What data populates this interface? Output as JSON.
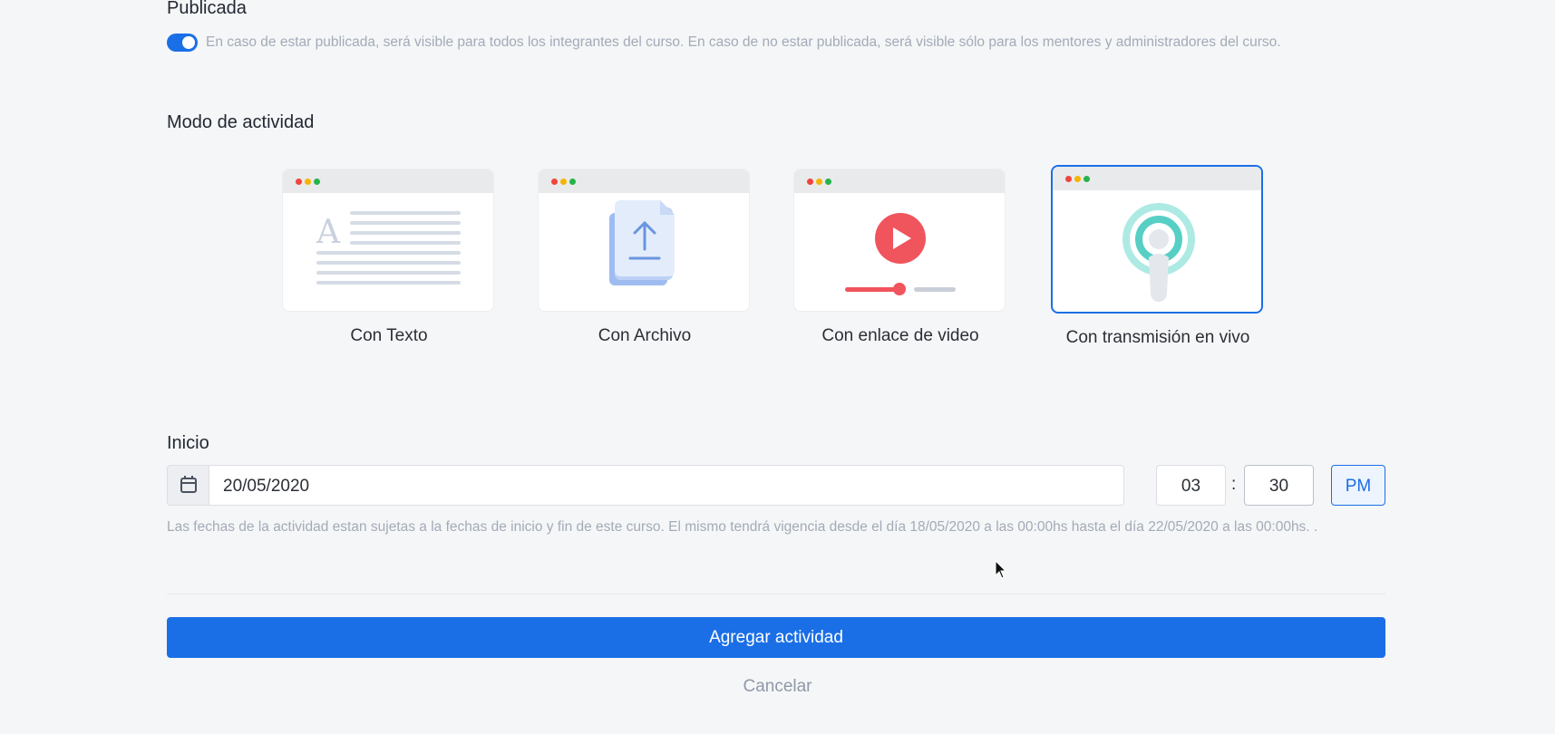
{
  "published": {
    "label": "Publicada",
    "toggle_on": true,
    "hint": "En caso de estar publicada, será visible para todos los integrantes del curso. En caso de no estar publicada, será visible sólo para los mentores y administradores del curso."
  },
  "mode": {
    "label": "Modo de actividad",
    "options": [
      {
        "label": "Con Texto",
        "icon": "text-document-icon",
        "selected": false
      },
      {
        "label": "Con Archivo",
        "icon": "file-upload-icon",
        "selected": false
      },
      {
        "label": "Con enlace de video",
        "icon": "video-play-icon",
        "selected": false
      },
      {
        "label": "Con transmisión en vivo",
        "icon": "live-broadcast-icon",
        "selected": true
      }
    ]
  },
  "start": {
    "label": "Inicio",
    "date": "20/05/2020",
    "hour": "03",
    "minute": "30",
    "separator": ":",
    "meridiem": "PM",
    "hint": "Las fechas de la actividad estan sujetas a la fechas de inicio y fin de este curso. El mismo tendrá vigencia desde el día 18/05/2020 a las 00:00hs hasta el día 22/05/2020 a las 00:00hs. ."
  },
  "actions": {
    "submit_label": "Agregar actividad",
    "cancel_label": "Cancelar"
  },
  "colors": {
    "accent": "#1a6fe6",
    "background": "#f5f6f7"
  }
}
